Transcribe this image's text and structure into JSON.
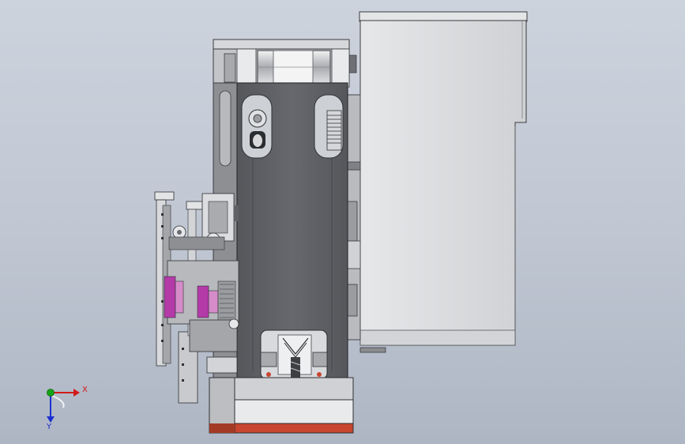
{
  "view": {
    "description_hidden": true
  },
  "triad": {
    "x_label": "X",
    "y_label": "Y",
    "x_color": "#d11a1a",
    "y_color": "#1b2fd1",
    "origin_color": "#17a317"
  },
  "colors": {
    "background_top": "#cdd3dd",
    "background_bottom": "#aeb6c4",
    "cabinet_fill": "#dadcde",
    "frame_dark": "#5f6166",
    "frame_mid": "#8c8f95",
    "frame_light": "#c6c8cc",
    "accent_magenta": "#b43aa8",
    "accent_red": "#c8452f"
  }
}
